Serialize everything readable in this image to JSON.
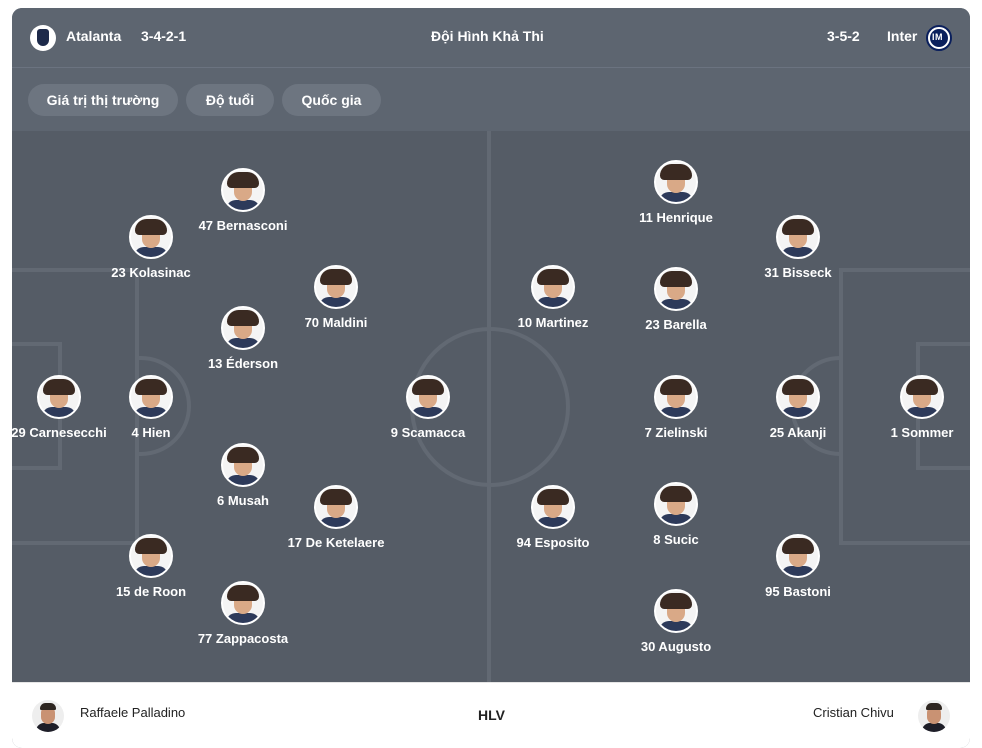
{
  "header": {
    "home_team": "Atalanta",
    "home_formation": "3-4-2-1",
    "title": "Đội Hình Khả Thi",
    "away_formation": "3-5-2",
    "away_team": "Inter"
  },
  "tabs": [
    {
      "label": "Giá trị thị trường"
    },
    {
      "label": "Độ tuổi"
    },
    {
      "label": "Quốc gia"
    }
  ],
  "home_players": [
    {
      "name": "47 Bernasconi"
    },
    {
      "name": "23 Kolasinac"
    },
    {
      "name": "70 Maldini"
    },
    {
      "name": "13 Éderson"
    },
    {
      "name": "29 Carnesecchi"
    },
    {
      "name": "4 Hien"
    },
    {
      "name": "9 Scamacca"
    },
    {
      "name": "6 Musah"
    },
    {
      "name": "17 De Ketelaere"
    },
    {
      "name": "15 de Roon"
    },
    {
      "name": "77 Zappacosta"
    }
  ],
  "away_players": [
    {
      "name": "11 Henrique"
    },
    {
      "name": "31 Bisseck"
    },
    {
      "name": "10 Martinez"
    },
    {
      "name": "23 Barella"
    },
    {
      "name": "7 Zielinski"
    },
    {
      "name": "25 Akanji"
    },
    {
      "name": "1 Sommer"
    },
    {
      "name": "94 Esposito"
    },
    {
      "name": "8 Sucic"
    },
    {
      "name": "95 Bastoni"
    },
    {
      "name": "30 Augusto"
    }
  ],
  "footer": {
    "home_coach": "Raffaele Palladino",
    "label": "HLV",
    "away_coach": "Cristian Chivu"
  },
  "colors": {
    "pitch": "#555c66",
    "header": "#5d6570",
    "tab_bg": "#6d7580",
    "pitch_lines": "#626973"
  }
}
